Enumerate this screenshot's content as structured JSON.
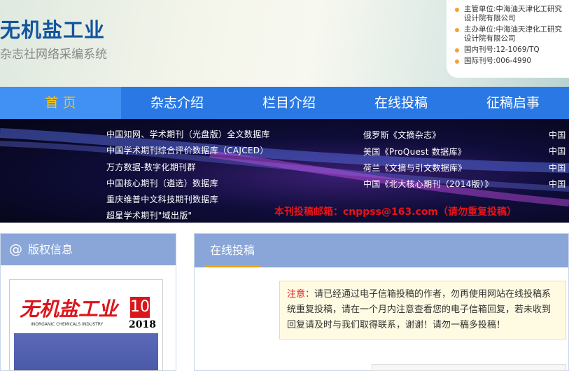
{
  "header": {
    "title": "无机盐工业",
    "subtitle": "杂志社网络采编系统",
    "info": [
      "主管单位:中海油天津化工研究设计院有限公司",
      "主办单位:中海油天津化工研究设计院有限公司",
      "国内刊号:12-1069/TQ",
      "国际刊号:006-4990"
    ]
  },
  "nav": [
    "首 页",
    "杂志介绍",
    "栏目介绍",
    "在线投稿",
    "征稿启事"
  ],
  "banner": {
    "col1": [
      "中国知网、学术期刊（光盘版）全文数据库",
      "中国学术期刊综合评价数据库（CAJCED）",
      "万方数据-数字化期刊群",
      "中国核心期刊（遴选）数据库",
      "重庆维普中文科技期刊数据库",
      "超星学术期刊\"域出版\""
    ],
    "col2": [
      "俄罗斯《文摘杂志》",
      "美国《ProQuest 数据库》",
      "荷兰《文摘与引文数据库》",
      "中国《北大核心期刊（2014版）》"
    ],
    "col3": [
      "中国",
      "中国",
      "中国",
      "中国"
    ],
    "email_notice": "本刊投稿邮箱：cnppss@163.com（请勿重复投稿）"
  },
  "left_panel": {
    "icon": "@",
    "title": "版权信息",
    "cover": {
      "title": "无机盐工业",
      "english": "INORGANIC CHEMICALS INDUSTRY",
      "issue": "10",
      "year": "2018"
    }
  },
  "right_panel": {
    "tab": "在线投稿",
    "notice_label": "注意：",
    "notice_lines": [
      "请已经通过电子信箱投稿的作者，勿再使用网站在线投稿系统重复投稿，请在一个月",
      "内注意查看您的电子信箱回复，若未收到回复请及时与我们取得联系，谢谢！请勿一稿多投",
      "稿！"
    ]
  },
  "colors": {
    "nav": "#2a78e4",
    "nav_active": "#4190f3",
    "panel_head": "#8aa6d8",
    "accent": "#f5a300",
    "title": "#12559e"
  }
}
